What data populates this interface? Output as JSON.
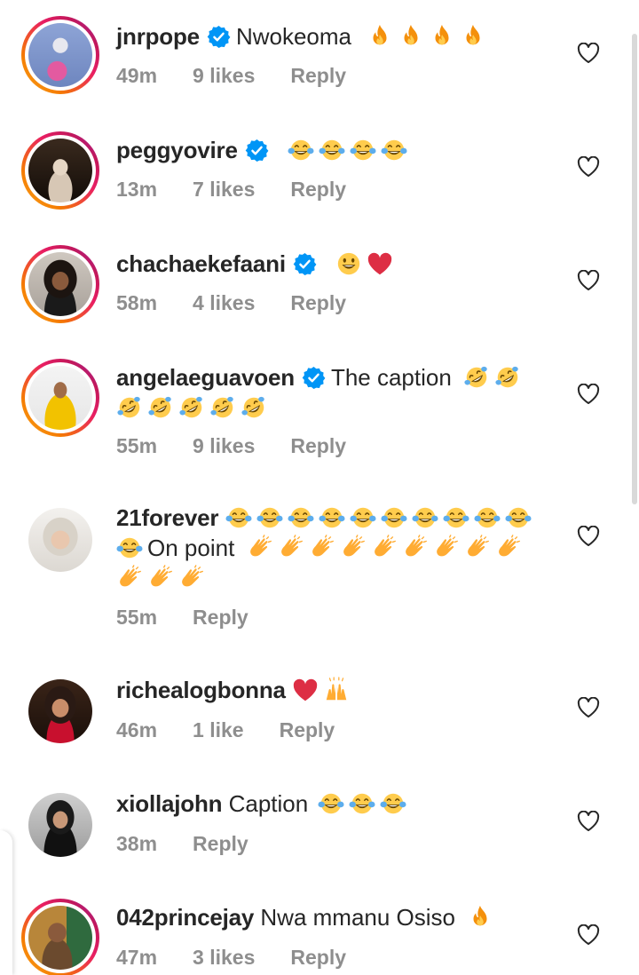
{
  "comments": [
    {
      "username": "jnrpope",
      "verified": true,
      "text": "Nwokeoma",
      "emojis_after": [
        "fire",
        "fire",
        "fire",
        "fire"
      ],
      "time": "49m",
      "likes": "9 likes",
      "reply": "Reply",
      "ring": true
    },
    {
      "username": "peggyovire",
      "verified": true,
      "text": "",
      "emojis_after": [
        "tears-of-joy",
        "tears-of-joy",
        "tears-of-joy",
        "tears-of-joy"
      ],
      "time": "13m",
      "likes": "7 likes",
      "reply": "Reply",
      "ring": true
    },
    {
      "username": "chachaekefaani",
      "verified": true,
      "text": "",
      "emojis_after": [
        "grinning",
        "red-heart"
      ],
      "time": "58m",
      "likes": "4 likes",
      "reply": "Reply",
      "ring": true
    },
    {
      "username": "angelaeguavoen",
      "verified": true,
      "text": "The caption",
      "emojis_after": [
        "rofl",
        "rofl",
        "rofl",
        "rofl",
        "rofl",
        "rofl",
        "rofl"
      ],
      "time": "55m",
      "likes": "9 likes",
      "reply": "Reply",
      "ring": true
    },
    {
      "username": "21forever",
      "verified": false,
      "text_before": "",
      "text": "On point",
      "time": "55m",
      "likes": "",
      "reply": "Reply",
      "ring": false
    },
    {
      "username": "richealogbonna",
      "verified": false,
      "text": "",
      "time": "46m",
      "likes": "1 like",
      "reply": "Reply",
      "ring": false
    },
    {
      "username": "xiollajohn",
      "verified": false,
      "text": "Caption",
      "time": "38m",
      "likes": "",
      "reply": "Reply",
      "ring": false
    },
    {
      "username": "042princejay",
      "verified": false,
      "text": "Nwa mmanu Osiso",
      "time": "47m",
      "likes": "3 likes",
      "reply": "Reply",
      "ring": true
    }
  ],
  "colors": {
    "verified": "#0095f6",
    "meta": "#8e8e8e",
    "text": "#262626"
  }
}
